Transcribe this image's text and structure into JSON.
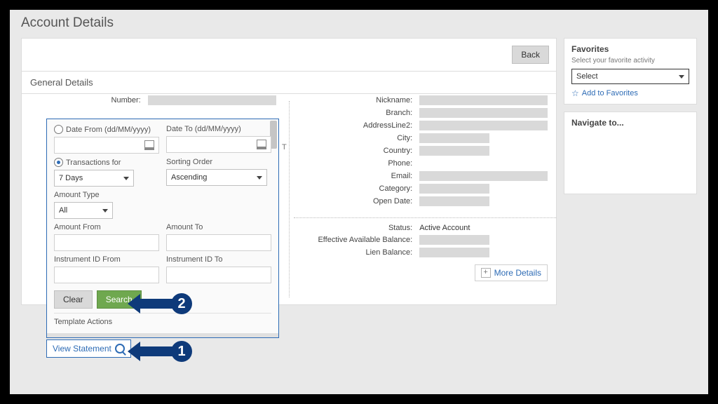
{
  "pageTitle": "Account Details",
  "topbar": {
    "back": "Back"
  },
  "section": {
    "generalDetails": "General Details"
  },
  "left": {
    "numberLabel": "Number:",
    "behindT": "T"
  },
  "right": {
    "rows": [
      "Nickname:",
      "Branch:",
      "AddressLine2:",
      "City:",
      "Country:",
      "Phone:",
      "Email:",
      "Category:",
      "Open Date:"
    ],
    "lower": {
      "statusLabel": "Status:",
      "statusValue": "Active Account",
      "eabLabel": "Effective Available Balance:",
      "lienLabel": "Lien Balance:"
    },
    "moreDetails": "More Details"
  },
  "search": {
    "dateFromLabel": "Date From (dd/MM/yyyy)",
    "dateToLabel": "Date To (dd/MM/yyyy)",
    "transForLabel": "Transactions for",
    "transForValue": "7 Days",
    "sortLabel": "Sorting Order",
    "sortValue": "Ascending",
    "amtTypeLabel": "Amount Type",
    "amtTypeValue": "All",
    "amtFromLabel": "Amount From",
    "amtToLabel": "Amount To",
    "instFromLabel": "Instrument ID From",
    "instToLabel": "Instrument ID To",
    "clear": "Clear",
    "searchBtn": "Search",
    "templateActions": "Template Actions"
  },
  "viewStatement": "View Statement",
  "favorites": {
    "title": "Favorites",
    "sub": "Select your favorite activity",
    "selectValue": "Select",
    "addLink": "Add to Favorites"
  },
  "navigate": {
    "title": "Navigate to..."
  },
  "callouts": {
    "one": "1",
    "two": "2"
  }
}
